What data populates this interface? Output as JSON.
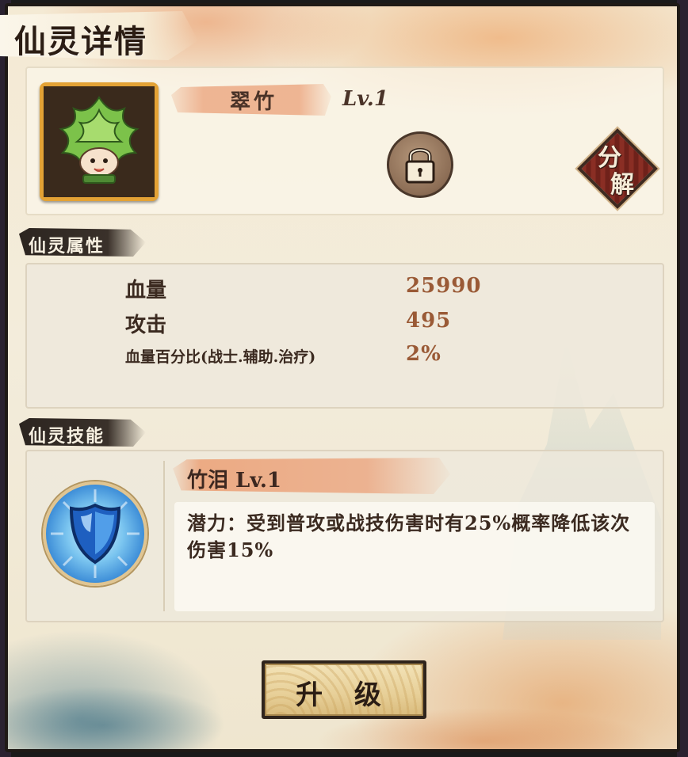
{
  "window": {
    "title": "仙灵详情"
  },
  "spirit": {
    "name": "翠竹",
    "level": "Lv.1"
  },
  "actions": {
    "decompose_line1": "分",
    "decompose_line2": "解",
    "upgrade_label": "升 级"
  },
  "attributes": {
    "header": "仙灵属性",
    "rows": [
      {
        "label": "血量",
        "value": "25990"
      },
      {
        "label": "攻击",
        "value": "495"
      },
      {
        "label": "血量百分比(战士.辅助.治疗)",
        "value": "2%"
      }
    ]
  },
  "skills": {
    "header": "仙灵技能",
    "title": "竹泪 Lv.1",
    "description": "潜力：受到普攻或战技伤害时有25%概率降低该次伤害15%"
  },
  "icons": {
    "avatar": "leaf-spirit-avatar",
    "lock": "lock-icon",
    "skill": "blue-shield-icon"
  },
  "colors": {
    "value_text": "#9a5a36",
    "avatar_border": "#e3a235",
    "accent_brush": "#eba078"
  }
}
